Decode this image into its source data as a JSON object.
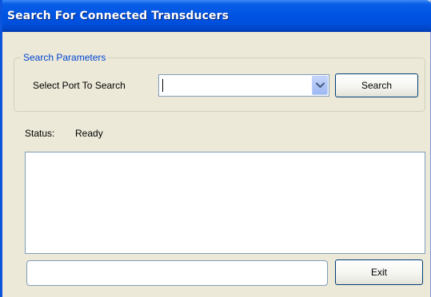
{
  "window": {
    "title": "Search For Connected Transducers"
  },
  "search_parameters": {
    "legend": "Search Parameters",
    "port_label": "Select Port To Search",
    "port_value": "",
    "search_button_label": "Search"
  },
  "status": {
    "label": "Status:",
    "value": "Ready"
  },
  "results": {
    "items": []
  },
  "footer": {
    "message_value": "",
    "exit_button_label": "Exit"
  },
  "colors": {
    "title_bar": "#0054e3",
    "legend_text": "#0046d5",
    "window_bg": "#ece9d8"
  },
  "icons": {
    "dropdown": "chevron-down-icon"
  }
}
